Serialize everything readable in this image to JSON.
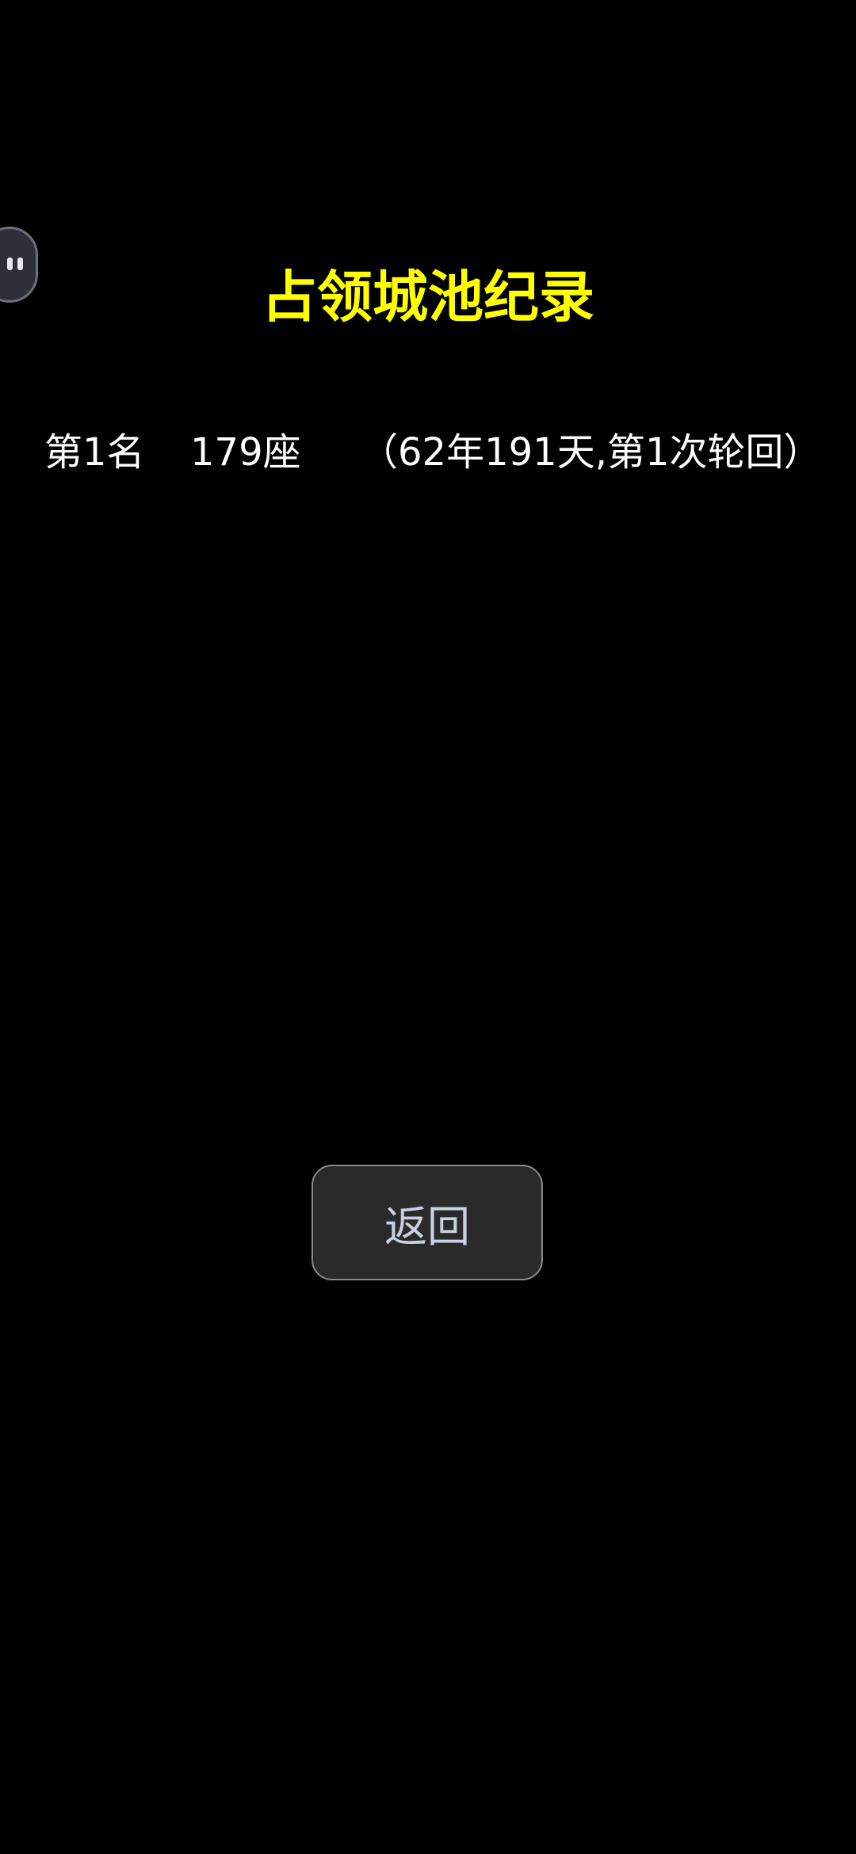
{
  "icons": {
    "floating_ball": "assistant-ball-icon"
  },
  "colors": {
    "background": "#000000",
    "title": "#ffff00",
    "record_text": "#ffffff",
    "button_bg": "#2a2a2a",
    "button_text": "#c9d0e0"
  },
  "page": {
    "title": "占领城池纪录"
  },
  "records": [
    {
      "rank": "第1名",
      "cities": "179座",
      "detail": "（62年191天,第1次轮回）"
    }
  ],
  "buttons": {
    "back_label": "返回"
  }
}
